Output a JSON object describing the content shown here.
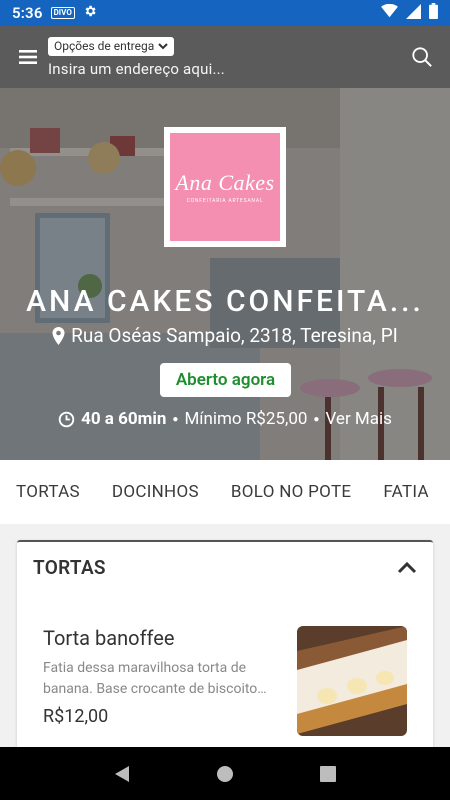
{
  "status_bar": {
    "time": "5:36",
    "badge": "DIVO",
    "icons": [
      "settings-icon",
      "wifi-icon",
      "cellular-icon",
      "battery-icon"
    ]
  },
  "header": {
    "menu_icon": "hamburger-menu-icon",
    "delivery_select": "Opções de entrega",
    "address_placeholder": "Insira um endereço aqui...",
    "search_icon": "search-icon"
  },
  "store": {
    "name": "ANA CAKES CONFEITA...",
    "logo_text": "Ana Cakes",
    "logo_subtext": "CONFEITARIA ARTESANAL",
    "address": "Rua Oséas Sampaio, 2318, Teresina, PI",
    "status": "Aberto agora",
    "delivery_time": "40 a 60min",
    "minimum": "Mínimo R$25,00",
    "more": "Ver Mais"
  },
  "tabs": [
    "TORTAS",
    "DOCINHOS",
    "BOLO NO POTE",
    "FATIA"
  ],
  "section": {
    "title": "TORTAS",
    "products": [
      {
        "name": "Torta banoffee",
        "description": "Fatia dessa maravilhosa torta de banana. Base crocante de biscoito…",
        "price": "R$12,00"
      }
    ]
  },
  "colors": {
    "status_bar": "#1565c0",
    "appbar": "#5b5b5b",
    "open_green": "#1e8e2e",
    "logo_pink": "#f48fb1"
  }
}
